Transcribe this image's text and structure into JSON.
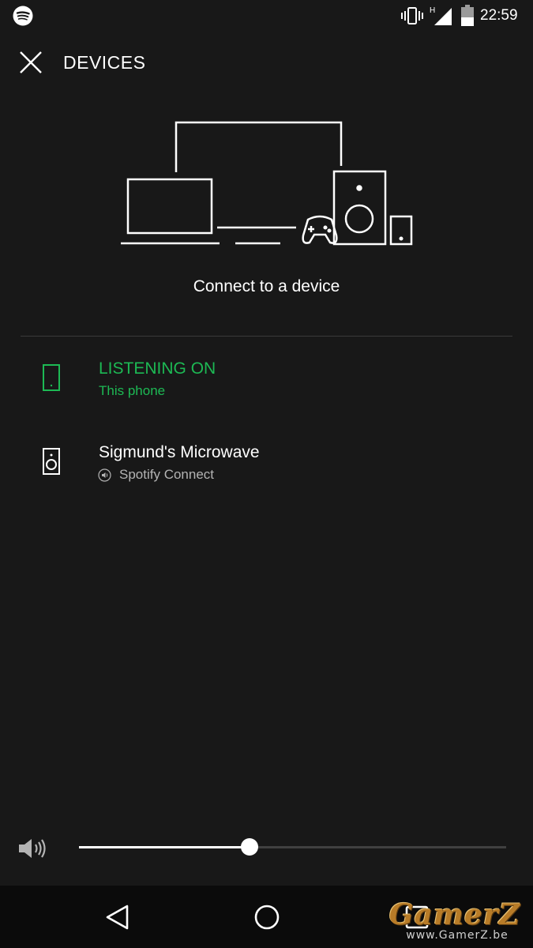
{
  "status_bar": {
    "time": "22:59",
    "network_type": "H",
    "icons": [
      "spotify-icon",
      "vibrate-icon",
      "signal-icon",
      "battery-icon"
    ]
  },
  "header": {
    "title": "DEVICES",
    "close_icon": "close-icon"
  },
  "main": {
    "heading": "Connect to a device",
    "illustration_icon": "devices-illustration-icon"
  },
  "devices": [
    {
      "name": "LISTENING ON",
      "subtitle": "This phone",
      "icon": "phone-icon",
      "active": true
    },
    {
      "name": "Sigmund's Microwave",
      "subtitle": "Spotify Connect",
      "icon": "speaker-icon",
      "sub_icon": "spotify-connect-icon",
      "active": false
    }
  ],
  "volume": {
    "icon": "volume-icon",
    "level": 0.4
  },
  "nav_bar": {
    "icons": [
      "back-icon",
      "home-icon",
      "recents-icon"
    ]
  },
  "watermark": {
    "text": "GamerZ",
    "url": "www.GamerZ.be"
  },
  "colors": {
    "background": "#181818",
    "accent": "#1db954",
    "text_primary": "#ffffff",
    "text_secondary": "#b3b3b3",
    "divider": "#3a3a3a",
    "nav_bar": "#0b0b0b"
  }
}
